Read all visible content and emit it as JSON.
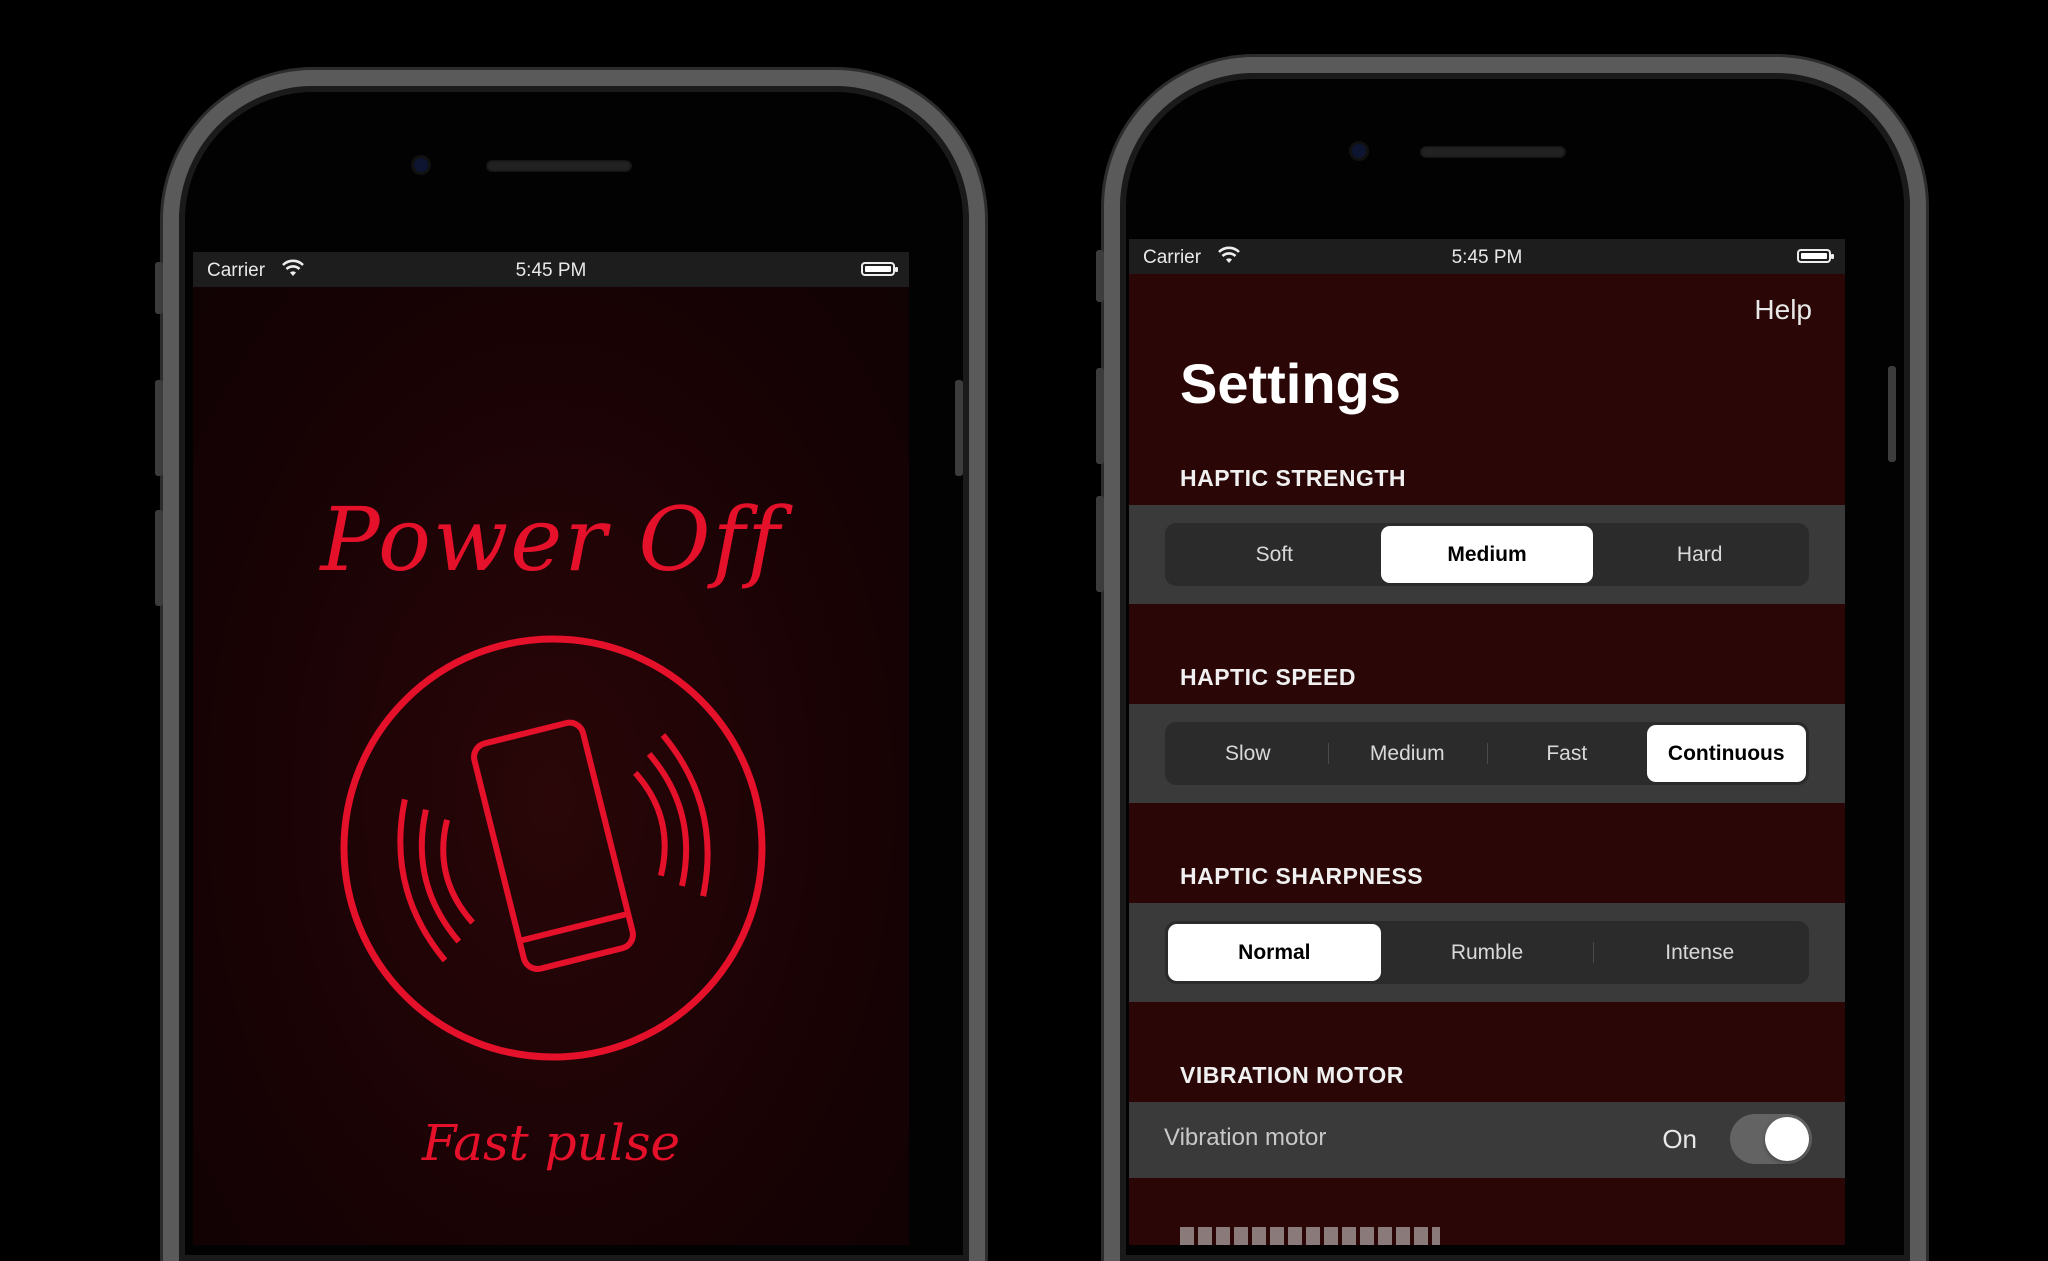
{
  "left_phone": {
    "status_bar": {
      "carrier": "Carrier",
      "time": "5:45 PM"
    },
    "title": "Power Off",
    "mode": "Fast pulse",
    "accent_color": "#e5102a",
    "icon": "phone-vibrating-icon"
  },
  "right_phone": {
    "status_bar": {
      "carrier": "Carrier",
      "time": "5:45 PM"
    },
    "help_label": "Help",
    "title": "Settings",
    "haptic_strength": {
      "header": "HAPTIC STRENGTH",
      "options": [
        "Soft",
        "Medium",
        "Hard"
      ],
      "selected": "Medium"
    },
    "haptic_speed": {
      "header": "HAPTIC SPEED",
      "options": [
        "Slow",
        "Medium",
        "Fast",
        "Continuous"
      ],
      "selected": "Continuous"
    },
    "haptic_sharpness": {
      "header": "HAPTIC SHARPNESS",
      "options": [
        "Normal",
        "Rumble",
        "Intense"
      ],
      "selected": "Normal"
    },
    "vibration_motor": {
      "header": "VIBRATION MOTOR",
      "row_label": "Vibration motor",
      "value": "On",
      "enabled": true
    }
  }
}
